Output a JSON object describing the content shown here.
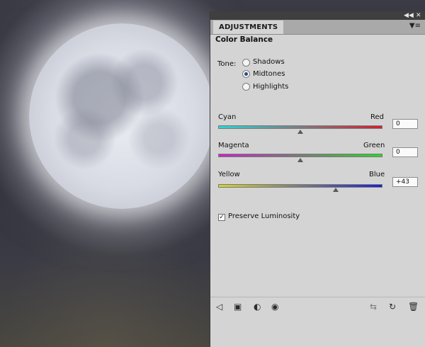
{
  "panel": {
    "tab_label": "ADJUSTMENTS",
    "title": "Color Balance",
    "tone_label": "Tone:",
    "tones": [
      {
        "label": "Shadows",
        "selected": false
      },
      {
        "label": "Midtones",
        "selected": true
      },
      {
        "label": "Highlights",
        "selected": false
      }
    ],
    "sliders": [
      {
        "left_label": "Cyan",
        "right_label": "Red",
        "value": "0",
        "fraction": 0.5
      },
      {
        "left_label": "Magenta",
        "right_label": "Green",
        "value": "0",
        "fraction": 0.5
      },
      {
        "left_label": "Yellow",
        "right_label": "Blue",
        "value": "+43",
        "fraction": 0.715
      }
    ],
    "preserve_luminosity": {
      "label": "Preserve Luminosity",
      "checked": true
    }
  },
  "icons": {
    "collapse": "double-chevron-icon",
    "close": "close-icon",
    "panel_menu": "panel-menu-icon",
    "footer": [
      "back-arrow-icon",
      "clip-to-layer-icon",
      "layer-visibility-toggle-icon",
      "eye-icon",
      "view-previous-state-icon",
      "reset-icon",
      "trash-icon"
    ]
  },
  "colors": {
    "panel_bg": "#d4d4d4",
    "radio_selected": "#2a4a8a"
  }
}
